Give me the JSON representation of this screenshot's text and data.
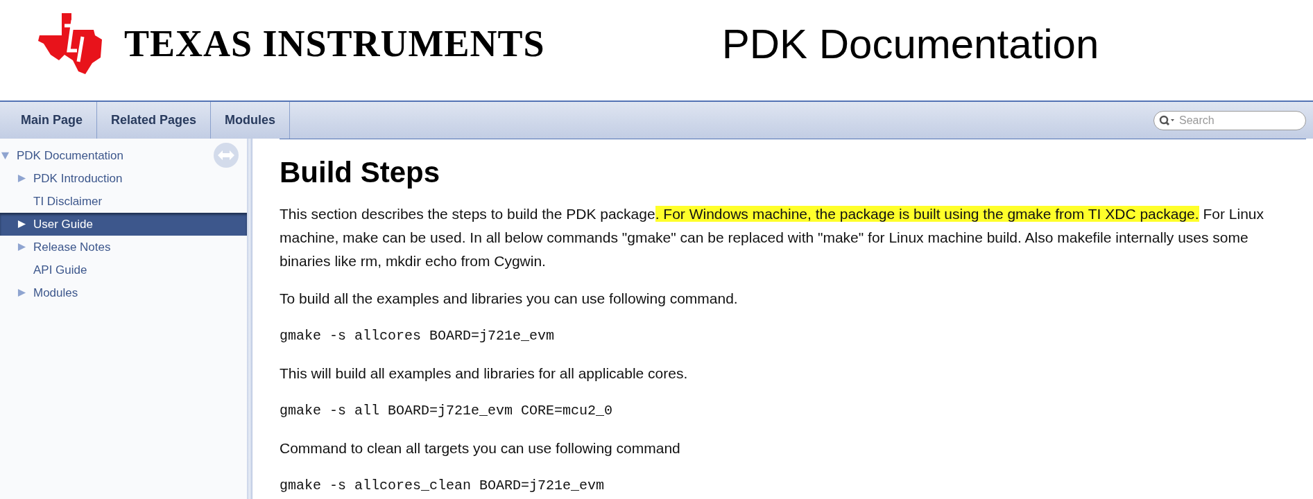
{
  "header": {
    "brand": "TEXAS INSTRUMENTS",
    "title": "PDK Documentation"
  },
  "nav": {
    "tabs": [
      {
        "label": "Main Page",
        "selected": false
      },
      {
        "label": "Related Pages",
        "selected": false
      },
      {
        "label": "Modules",
        "selected": false
      }
    ],
    "search": {
      "placeholder": "Search"
    }
  },
  "sidebar": {
    "items": [
      {
        "label": "PDK Documentation",
        "expanded": true,
        "selected": false,
        "children": [
          {
            "label": "PDK Introduction",
            "expanded": false,
            "selected": false
          },
          {
            "label": "TI Disclaimer",
            "selected": false
          },
          {
            "label": "User Guide",
            "expanded": false,
            "selected": true
          },
          {
            "label": "Release Notes",
            "expanded": false,
            "selected": false
          },
          {
            "label": "API Guide",
            "selected": false
          },
          {
            "label": "Modules",
            "expanded": false,
            "selected": false
          }
        ]
      }
    ]
  },
  "content": {
    "heading": "Build Steps",
    "blocks": [
      {
        "kind": "paragraph",
        "segments": [
          {
            "text": "This section describes the steps to build the PDK package",
            "highlighted": false
          },
          {
            "text": ". For Windows machine, the package is built using the gmake from TI XDC package.",
            "highlighted": true
          },
          {
            "text": " For Linux machine, make can be used. In all below commands \"gmake\" can be replaced with \"make\" for Linux machine build. Also makefile internally uses some binaries like rm, mkdir echo from Cygwin.",
            "highlighted": false
          }
        ]
      },
      {
        "kind": "paragraph",
        "segments": [
          {
            "text": "To build all the examples and libraries you can use following command.",
            "highlighted": false
          }
        ]
      },
      {
        "kind": "code",
        "text": "gmake -s allcores BOARD=j721e_evm"
      },
      {
        "kind": "paragraph",
        "segments": [
          {
            "text": "This will build all examples and libraries for all applicable cores.",
            "highlighted": false
          }
        ]
      },
      {
        "kind": "code",
        "text": "gmake -s all BOARD=j721e_evm CORE=mcu2_0"
      },
      {
        "kind": "paragraph",
        "segments": [
          {
            "text": "Command to clean all targets you can use following command",
            "highlighted": false
          }
        ]
      },
      {
        "kind": "code",
        "text": "gmake -s allcores_clean BOARD=j721e_evm"
      }
    ]
  }
}
